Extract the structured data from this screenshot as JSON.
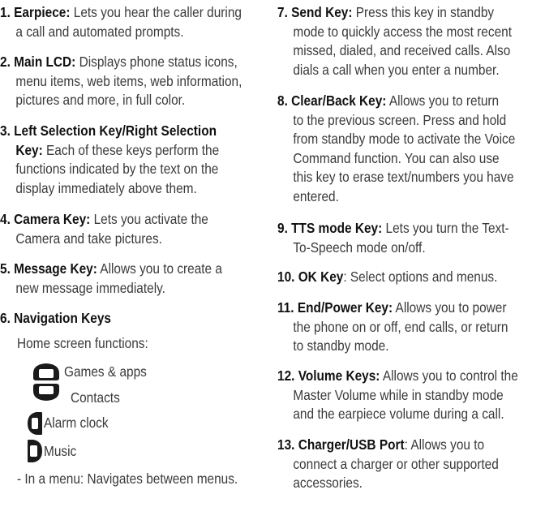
{
  "left": {
    "items": [
      {
        "num": "1.",
        "term": "Earpiece:",
        "lines": [
          "Lets you hear the caller during",
          "a call and automated prompts."
        ]
      },
      {
        "num": "2.",
        "term": "Main LCD:",
        "lines": [
          "Displays phone status icons,",
          "menu items, web items, web information,",
          "pictures and more, in full color."
        ]
      },
      {
        "num": "3.",
        "term": "Left Selection Key/Right Selection",
        "term2": "Key:",
        "lines": [
          "Each of these keys perform the",
          "functions indicated by the text on the",
          "display immediately above them."
        ]
      },
      {
        "num": "4.",
        "term": "Camera Key:",
        "lines": [
          "Lets you activate the",
          "Camera and take pictures."
        ]
      },
      {
        "num": "5.",
        "term": "Message Key:",
        "lines": [
          "Allows you to create a",
          "new message immediately."
        ]
      },
      {
        "num": "6.",
        "term": "Navigation Keys",
        "lines": []
      }
    ],
    "nav": {
      "intro": "Home screen functions:",
      "entries": [
        {
          "label": "Games & apps",
          "icon": "nav-up-key-icon"
        },
        {
          "label": "Contacts",
          "icon": "nav-down-key-icon"
        },
        {
          "label": "Alarm clock",
          "icon": "nav-left-key-icon"
        },
        {
          "label": "Music",
          "icon": "nav-right-key-icon"
        }
      ],
      "menu_note": "- In a menu: Navigates between menus."
    }
  },
  "right": {
    "items": [
      {
        "num": "7.",
        "term": "Send Key:",
        "lines": [
          "Press this key in standby",
          "mode to quickly access the most recent",
          "missed, dialed, and received calls. Also",
          "dials a call when you enter a number."
        ]
      },
      {
        "num": "8.",
        "term": "Clear/Back Key:",
        "lines": [
          "Allows you to return",
          "to the previous screen. Press and hold",
          "from standby mode to activate the Voice",
          "Command function. You can also use",
          "this key to erase text/numbers you have",
          "entered."
        ]
      },
      {
        "num": "9.",
        "term": "TTS mode Key:",
        "lines": [
          "Lets you turn the Text-",
          "To-Speech mode on/off."
        ]
      },
      {
        "num": "10.",
        "term": "OK Key",
        "lines": [
          ": Select options and menus."
        ]
      },
      {
        "num": "11.",
        "term": "End/Power Key:",
        "lines": [
          "Allows you to power",
          "the phone on or off, end calls, or return",
          "to standby mode."
        ]
      },
      {
        "num": "12.",
        "term": "Volume Keys:",
        "lines": [
          "Allows you to control the",
          "Master Volume while in standby mode",
          "and the earpiece volume during a call."
        ]
      },
      {
        "num": "13.",
        "term": "Charger/USB Port",
        "lines": [
          ": Allows you to",
          "connect a charger or other supported",
          "accessories."
        ]
      }
    ]
  }
}
